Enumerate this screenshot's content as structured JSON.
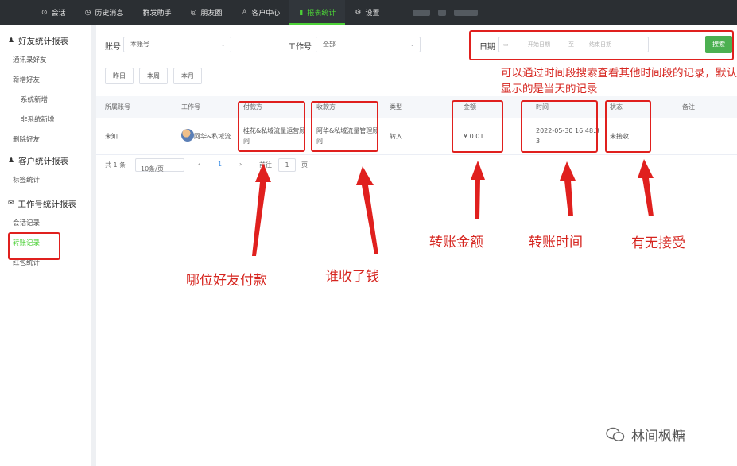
{
  "nav": {
    "items": [
      {
        "icon": "chat-icon",
        "glyph": "⊙",
        "label": "会话"
      },
      {
        "icon": "history-icon",
        "glyph": "◷",
        "label": "历史消息"
      },
      {
        "icon": "",
        "glyph": "",
        "label": "群发助手"
      },
      {
        "icon": "moments-icon",
        "glyph": "◎",
        "label": "朋友圈"
      },
      {
        "icon": "user-icon",
        "glyph": "♙",
        "label": "客户中心"
      },
      {
        "icon": "bar-chart-icon",
        "glyph": "▮",
        "label": "报表统计"
      },
      {
        "icon": "settings-icon",
        "glyph": "⚙",
        "label": "设置"
      }
    ],
    "active_index": 5
  },
  "sidebar": {
    "groups": [
      {
        "icon": "user-icon",
        "glyph": "♟",
        "title": "好友统计报表",
        "items": [
          {
            "label": "通讯录好友",
            "sub": false
          },
          {
            "label": "新增好友",
            "sub": false
          },
          {
            "label": "系统新增",
            "sub": true
          },
          {
            "label": "非系统新增",
            "sub": true
          },
          {
            "label": "删除好友",
            "sub": false
          }
        ]
      },
      {
        "icon": "user-icon",
        "glyph": "♟",
        "title": "客户统计报表",
        "items": [
          {
            "label": "标签统计",
            "sub": false
          }
        ]
      },
      {
        "icon": "wechat-icon",
        "glyph": "✉",
        "title": "工作号统计报表",
        "items": [
          {
            "label": "会话记录",
            "sub": false
          },
          {
            "label": "转账记录",
            "sub": false
          },
          {
            "label": "红包统计",
            "sub": false
          }
        ]
      }
    ],
    "active_label": "转账记录"
  },
  "filters": {
    "account_label": "账号",
    "account_value": "本账号",
    "work_label": "工作号",
    "work_value": "全部",
    "date_label": "日期",
    "start_placeholder": "开始日期",
    "separator": "至",
    "end_placeholder": "结束日期",
    "search_label": "搜索",
    "quick": [
      "昨日",
      "本周",
      "本月"
    ]
  },
  "table": {
    "columns": [
      "所属账号",
      "工作号",
      "付款方",
      "收款方",
      "类型",
      "金额",
      "时间",
      "状态",
      "备注"
    ],
    "rows": [
      {
        "account": "未知",
        "work": "阿华&私域流",
        "payer": "桂花&私域流量运营顾问",
        "payee": "阿华&私域流量管理顾问",
        "type": "转入",
        "amount": "¥ 0.01",
        "time": "2022-05-30 16:48:33",
        "status": "未接收",
        "remark": ""
      }
    ]
  },
  "pager": {
    "total": "共 1 条",
    "page_size": "10条/页",
    "prev": "‹",
    "page": "1",
    "next": "›",
    "goto": "前往",
    "goto_value": "1",
    "page_unit": "页"
  },
  "annotations": {
    "note": "可以通过时间段搜索查看其他时间段的记录，默认显示的是当天的记录",
    "payer": "哪位好友付款",
    "payee": "谁收了钱",
    "amount": "转账金额",
    "time": "转账时间",
    "status": "有无接受"
  },
  "watermark": "林间枫糖",
  "colors": {
    "accent": "#4cd137",
    "annotation": "#e0201e",
    "topbar": "#2b2f33"
  }
}
